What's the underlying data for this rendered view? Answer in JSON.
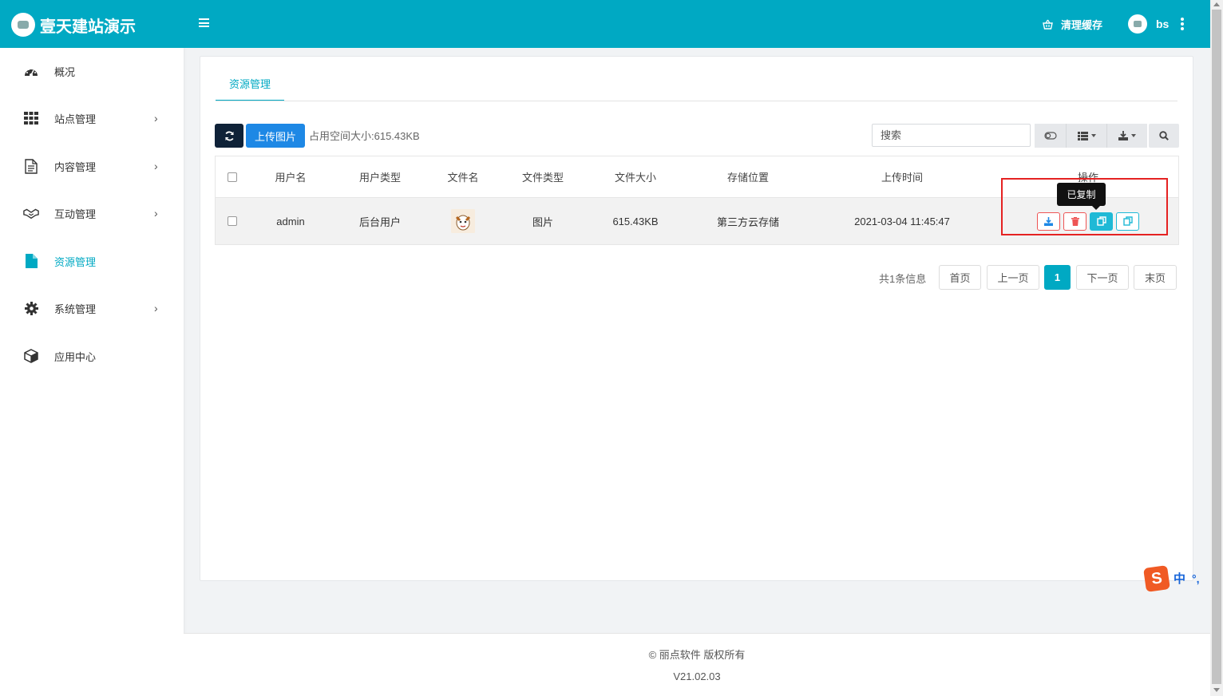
{
  "app": {
    "title": "壹天建站演示"
  },
  "header": {
    "clear_cache": "清理缓存",
    "username": "bs"
  },
  "sidebar": {
    "items": [
      {
        "label": "概况",
        "icon": "dashboard-icon",
        "has_children": false,
        "active": false
      },
      {
        "label": "站点管理",
        "icon": "grid-icon",
        "has_children": true,
        "active": false
      },
      {
        "label": "内容管理",
        "icon": "document-icon",
        "has_children": true,
        "active": false
      },
      {
        "label": "互动管理",
        "icon": "handshake-icon",
        "has_children": true,
        "active": false
      },
      {
        "label": "资源管理",
        "icon": "file-icon",
        "has_children": false,
        "active": true
      },
      {
        "label": "系统管理",
        "icon": "gear-icon",
        "has_children": true,
        "active": false
      },
      {
        "label": "应用中心",
        "icon": "cube-icon",
        "has_children": false,
        "active": false
      }
    ]
  },
  "main": {
    "tab": "资源管理",
    "toolbar": {
      "upload_label": "上传图片",
      "usage_text": "占用空间大小:615.43KB",
      "search_placeholder": "搜索"
    },
    "table": {
      "columns": [
        "用户名",
        "用户类型",
        "文件名",
        "文件类型",
        "文件大小",
        "存储位置",
        "上传时间",
        "操作"
      ],
      "rows": [
        {
          "username": "admin",
          "user_type": "后台用户",
          "file_type": "图片",
          "file_size": "615.43KB",
          "storage": "第三方云存储",
          "upload_time": "2021-03-04 11:45:47"
        }
      ]
    },
    "tooltip": "已复制",
    "pagination": {
      "total": "共1条信息",
      "first": "首页",
      "prev": "上一页",
      "current": "1",
      "next": "下一页",
      "last": "末页"
    }
  },
  "footer": {
    "copyright": "© 丽点软件 版权所有",
    "version": "V21.02.03"
  },
  "ime": {
    "logo": "S",
    "mode": "中",
    "punct": "°,"
  },
  "colors": {
    "accent": "#00a9c3",
    "primary_button": "#1e88e5",
    "danger": "#e55555",
    "highlight_box": "#e52222"
  }
}
